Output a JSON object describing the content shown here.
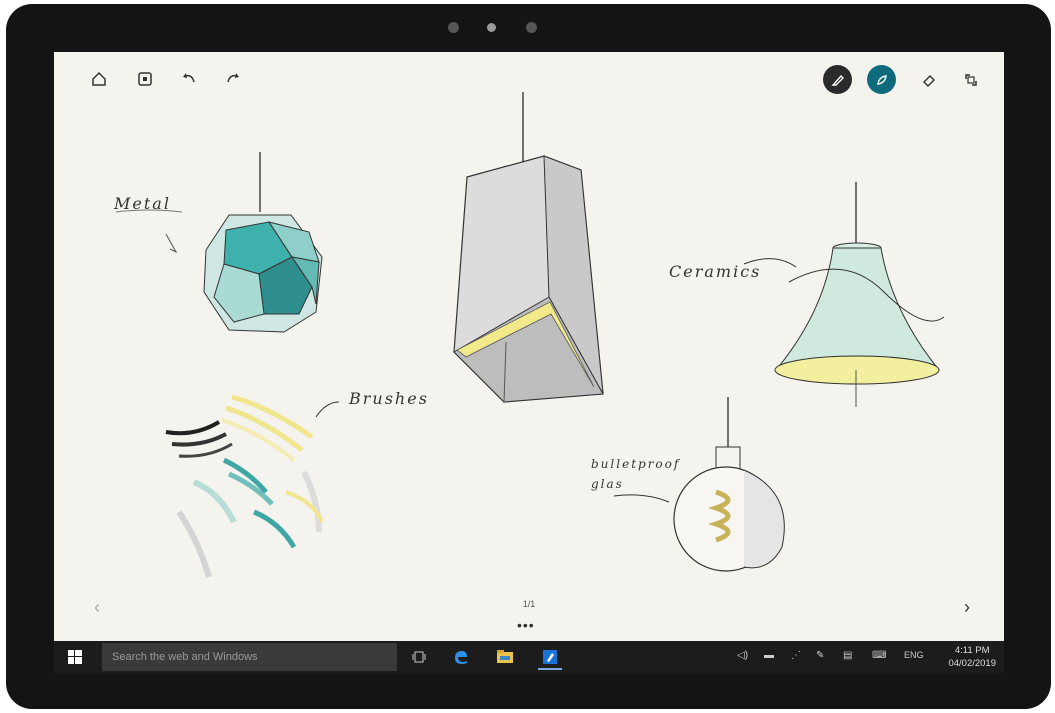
{
  "toolbar": {
    "left_icons": [
      "home-icon",
      "page-icon",
      "undo-icon",
      "redo-icon"
    ],
    "right_icons": [
      "pen-icon",
      "ink-brush-icon",
      "eraser-icon",
      "fullscreen-icon"
    ],
    "active_tool_color": "#0e6b7b"
  },
  "canvas": {
    "labels": {
      "metal": "Metal",
      "ceramics": "Ceramics",
      "brushes": "Brushes",
      "glass_line1": "bulletproof",
      "glass_line2": "glas"
    },
    "page_indicator": "1/1",
    "more": "•••",
    "prev": "‹",
    "next": "›"
  },
  "taskbar": {
    "search_placeholder": "Search the web and Windows",
    "language": "ENG",
    "time": "4:11 PM",
    "date": "04/02/2019",
    "accent": "#1a72d6"
  }
}
